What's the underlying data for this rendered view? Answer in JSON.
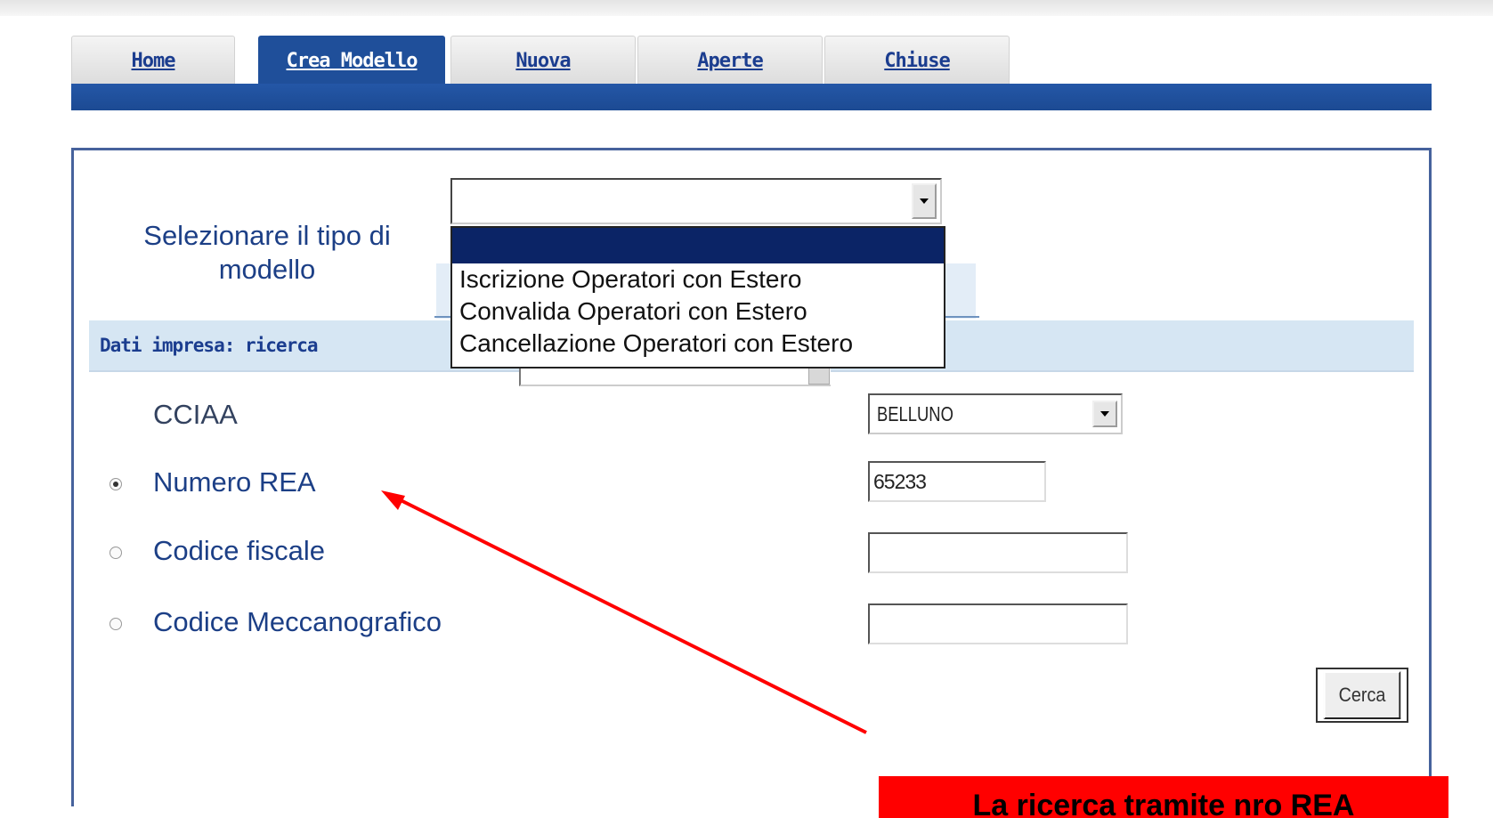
{
  "tabs": [
    {
      "label": "Home"
    },
    {
      "label": "Crea Modello"
    },
    {
      "label": "Nuova"
    },
    {
      "label": "Aperte"
    },
    {
      "label": "Chiuse"
    }
  ],
  "active_tab": "Crea Modello",
  "form": {
    "select_model_label": "Selezionare il tipo di modello",
    "model_select_value": "",
    "model_options": [
      "",
      "Iscrizione Operatori con Estero",
      "Convalida Operatori con Estero",
      "Cancellazione Operatori con Estero"
    ],
    "section_header": "Dati impresa: ricerca",
    "cciaa_label": "CCIAA",
    "cciaa_value": "BELLUNO",
    "rea_label": "Numero REA",
    "rea_value": "65233",
    "codice_fiscale_label": "Codice fiscale",
    "codice_fiscale_value": "",
    "codice_mecc_label": "Codice Meccanografico",
    "codice_mecc_value": "",
    "selected_search": "Numero REA",
    "search_button": "Cerca"
  },
  "annotation": {
    "callout_text": "La ricerca tramite nro REA",
    "color": "#ff0000"
  },
  "colors": {
    "nav_blue": "#1f4f9a",
    "label_blue": "#1c3f86",
    "header_strip": "#d6e6f3"
  }
}
